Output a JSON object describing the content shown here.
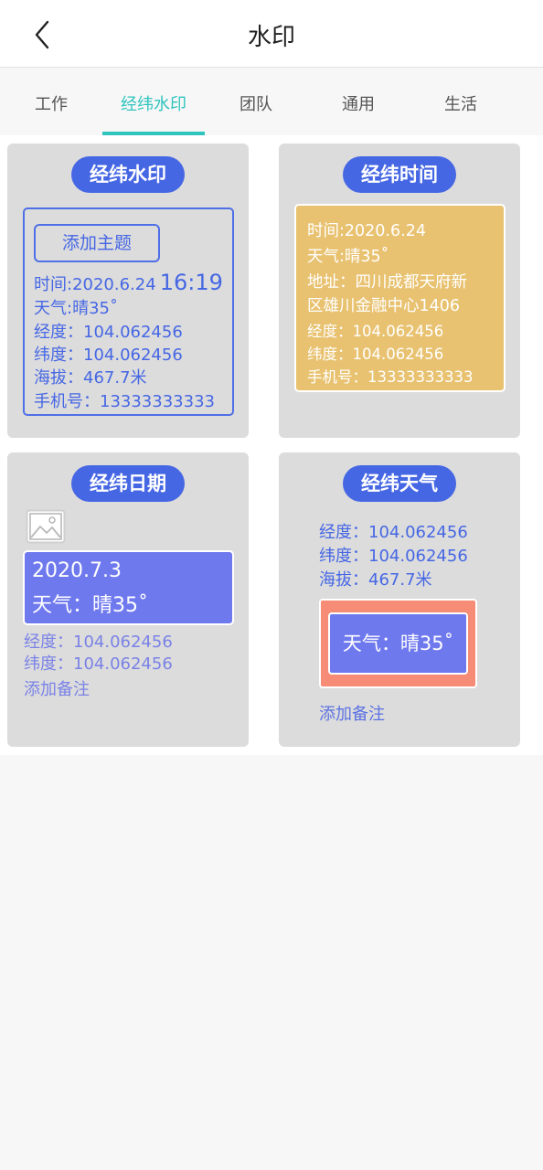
{
  "header": {
    "title": "水印",
    "back_icon": "chevron-left-icon"
  },
  "tabs": [
    {
      "label": "工作",
      "active": false
    },
    {
      "label": "经纬水印",
      "active": true
    },
    {
      "label": "团队",
      "active": false
    },
    {
      "label": "通用",
      "active": false
    },
    {
      "label": "生活",
      "active": false
    }
  ],
  "colors": {
    "accent": "#2fc4be",
    "pill": "#4667e4",
    "gold": "#e8c270",
    "violet": "#6f79ee",
    "salmon": "#f68b76"
  },
  "cards": {
    "jingwei_watermark": {
      "title": "经纬水印",
      "button": "添加主题",
      "time_label": "时间:2020.6.24",
      "time_clock": "16:19",
      "weather": "天气:晴35˚",
      "longitude": "经度：104.062456",
      "latitude": "纬度：104.062456",
      "altitude": "海拔：467.7米",
      "phone": "手机号：13333333333"
    },
    "jingwei_time": {
      "title": "经纬时间",
      "time": "时间:2020.6.24",
      "weather": "天气:晴35˚",
      "address_line1": "地址：四川成都天府新",
      "address_line2": "区雄川金融中心1406",
      "longitude": "经度：104.062456",
      "latitude": "纬度：104.062456",
      "phone": "手机号：13333333333"
    },
    "jingwei_date": {
      "title": "经纬日期",
      "image_icon": "image-placeholder-icon",
      "date": "2020.7.3",
      "weather": "天气：晴35˚",
      "longitude": "经度：104.062456",
      "latitude": "纬度：104.062456",
      "remark": "添加备注"
    },
    "jingwei_weather": {
      "title": "经纬天气",
      "longitude": "经度：104.062456",
      "latitude": "纬度：104.062456",
      "altitude": "海拔：467.7米",
      "weather": "天气：晴35˚",
      "remark": "添加备注"
    }
  }
}
